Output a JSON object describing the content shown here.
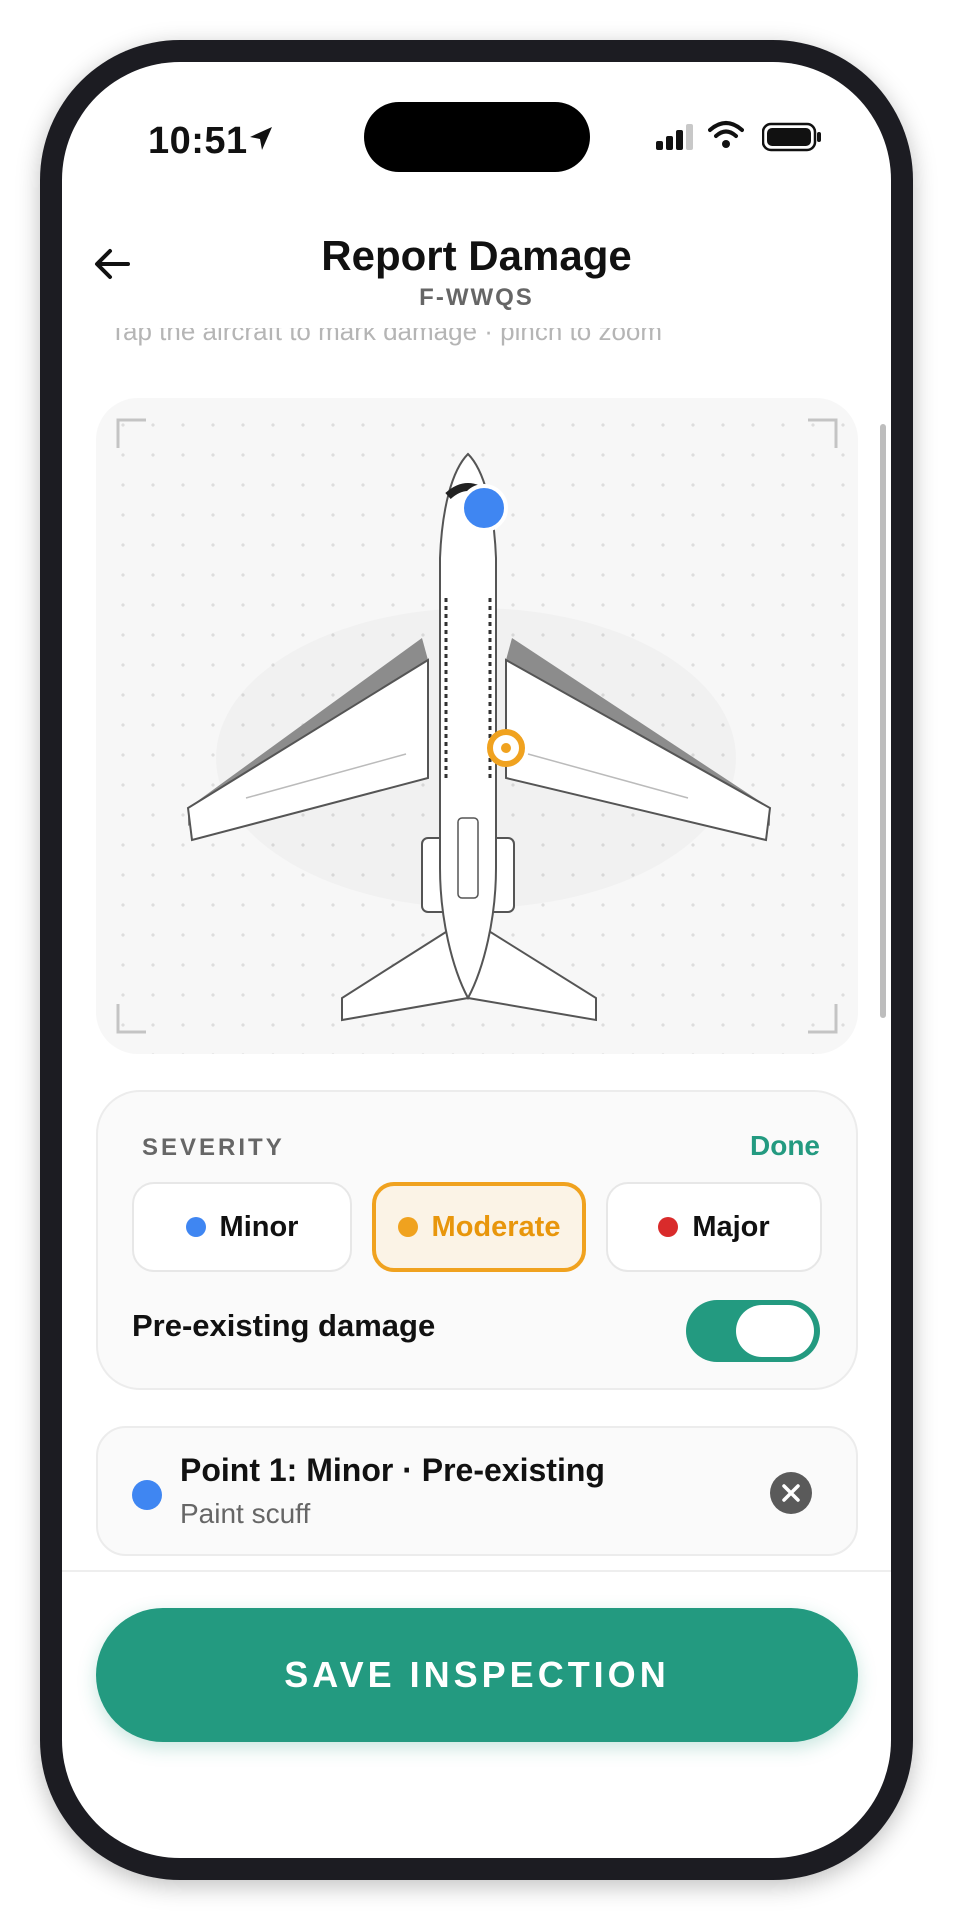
{
  "status": {
    "time": "10:51"
  },
  "header": {
    "title": "Report Damage",
    "subtitle": "F-WWQS",
    "hint": "Tap the aircraft to mark damage · pinch to zoom"
  },
  "markers": [
    {
      "severity": "Minor",
      "color": "#3f86f2"
    },
    {
      "severity": "Moderate",
      "color": "#f0a21f"
    }
  ],
  "severity": {
    "label": "SEVERITY",
    "done_label": "Done",
    "options": [
      {
        "label": "Minor",
        "color": "#3f86f2"
      },
      {
        "label": "Moderate",
        "color": "#f0a21f",
        "selected": true
      },
      {
        "label": "Major",
        "color": "#d92b2b"
      }
    ],
    "preexisting_label": "Pre-existing damage",
    "preexisting_on": true
  },
  "points": [
    {
      "title": "Point 1: Minor · Pre-existing",
      "description": "Paint scuff",
      "color": "#3f86f2"
    }
  ],
  "save_label": "SAVE INSPECTION",
  "colors": {
    "accent": "#239a80"
  }
}
